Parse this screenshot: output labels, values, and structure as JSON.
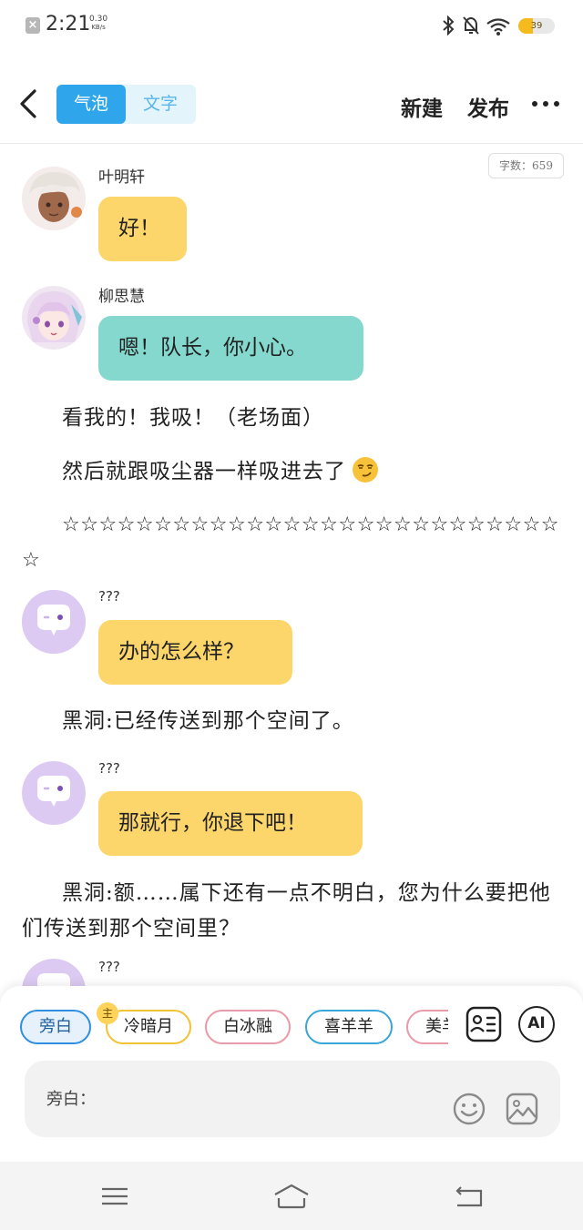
{
  "status_bar": {
    "time": "2:21",
    "speed_value": "0.30",
    "speed_unit": "KB/s",
    "battery": "39",
    "battery_level": 0.39
  },
  "header": {
    "mode_tabs": [
      "气泡",
      "文字"
    ],
    "active_tab": 0,
    "new_label": "新建",
    "publish_label": "发布"
  },
  "word_count": "字数：659",
  "messages": [
    {
      "type": "bubble",
      "speaker": "叶明轩",
      "text": "好！",
      "color": "#fdd66b",
      "avatar": "white-haired-character-avatar"
    },
    {
      "type": "bubble",
      "speaker": "柳思慧",
      "text": "嗯！队长，你小心。",
      "color": "#84d8ce",
      "avatar": "pink-haired-character-avatar"
    },
    {
      "type": "narration",
      "text": "看我的！我吸！（老场面）"
    },
    {
      "type": "narration",
      "text": "然后就跟吸尘器一样吸进去了",
      "emoji": "smirk-emoji"
    },
    {
      "type": "narration",
      "text": "☆☆☆☆☆☆☆☆☆☆☆☆☆☆☆☆☆☆☆☆☆☆☆☆☆☆☆☆"
    },
    {
      "type": "bubble",
      "speaker": "???",
      "text": "办的怎么样？",
      "color": "#fdd66b",
      "avatar": "chat-bubble-placeholder-avatar"
    },
    {
      "type": "narration",
      "text": "黑洞:已经传送到那个空间了。"
    },
    {
      "type": "bubble",
      "speaker": "???",
      "text": "那就行，你退下吧！",
      "color": "#fdd66b",
      "avatar": "chat-bubble-placeholder-avatar"
    },
    {
      "type": "narration",
      "text": "黑洞:额……属下还有一点不明白，您为什么要把他们传送到那个空间里？"
    },
    {
      "type": "bubble",
      "speaker": "???",
      "text": "",
      "color": "#fdd66b",
      "avatar": "chat-bubble-placeholder-avatar"
    }
  ],
  "role_chips": [
    {
      "label": "旁白",
      "border": "#2f8fe0",
      "active": true
    },
    {
      "label": "冷暗月",
      "border": "#f1c232",
      "badge": "主"
    },
    {
      "label": "白冰融",
      "border": "#e89aa8"
    },
    {
      "label": "喜羊羊",
      "border": "#3aa6d8"
    },
    {
      "label": "美羊羊",
      "border": "#e89aa8"
    }
  ],
  "input": {
    "label": "旁白："
  },
  "icons": {
    "role_card": "role-card-icon",
    "ai": "AI",
    "emoji": "emoji-icon",
    "image": "image-icon"
  }
}
